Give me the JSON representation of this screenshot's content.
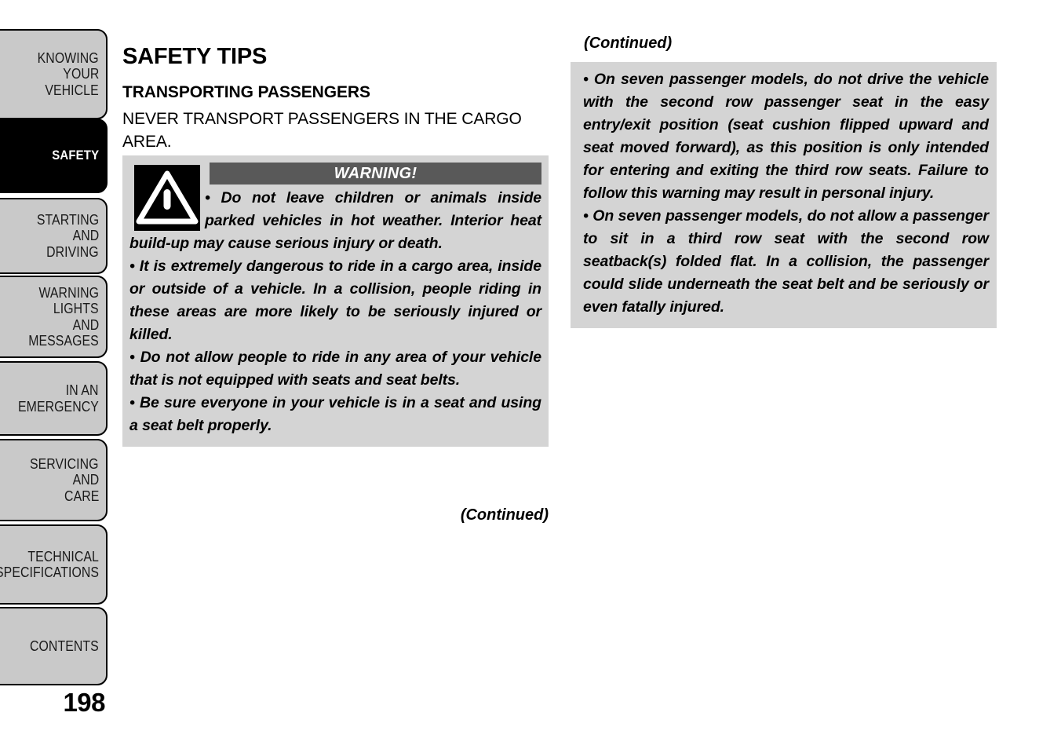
{
  "sidebar": {
    "tabs": [
      {
        "id": "knowing-your-vehicle",
        "lines": [
          "KNOWING",
          "YOUR",
          "VEHICLE"
        ],
        "active": false
      },
      {
        "id": "safety",
        "lines": [
          "SAFETY"
        ],
        "active": true
      },
      {
        "id": "starting-and-driving",
        "lines": [
          "STARTING",
          "AND",
          "DRIVING"
        ],
        "active": false
      },
      {
        "id": "warning-lights-and-messages",
        "lines": [
          "WARNING",
          "LIGHTS",
          "AND",
          "MESSAGES"
        ],
        "active": false
      },
      {
        "id": "in-an-emergency",
        "lines": [
          "IN AN",
          "EMERGENCY"
        ],
        "active": false
      },
      {
        "id": "servicing-and-care",
        "lines": [
          "SERVICING",
          "AND",
          "CARE"
        ],
        "active": false
      },
      {
        "id": "technical-specifications",
        "lines": [
          "TECHNICAL",
          "SPECIFICATIONS"
        ],
        "active": false
      },
      {
        "id": "contents",
        "lines": [
          "CONTENTS"
        ],
        "active": false
      }
    ],
    "page_number": "198"
  },
  "colors": {
    "tab_inactive_bg": "#c9c9c9",
    "tab_active_bg": "#000000",
    "warning_box_bg": "#d4d4d4",
    "warning_banner_bg": "#595959",
    "text": "#000000"
  },
  "left": {
    "section_title": "SAFETY TIPS",
    "subsection_title": "TRANSPORTING PASSENGERS",
    "intro_text": "NEVER TRANSPORT PASSENGERS IN THE CARGO AREA.",
    "warning": {
      "icon_name": "warning-triangle-icon",
      "banner_label": "WARNING!",
      "items": [
        "•  Do not leave children or animals inside parked vehicles in hot weather. Interior heat build-up may cause serious injury or death.",
        "•  It is extremely dangerous to ride in a cargo area, inside or outside of a vehicle. In a collision, people riding in these areas are more likely to be seriously injured or killed.",
        "•  Do not allow people to ride in any area of your vehicle that is not equipped with seats and seat belts.",
        "•  Be sure everyone in your vehicle is in a seat and using a seat belt properly."
      ]
    },
    "continued_label": "(Continued)"
  },
  "right": {
    "continued_label": "(Continued)",
    "warning": {
      "items": [
        "•  On seven passenger models, do not drive the vehicle with the second row passenger seat in the easy entry/exit position (seat cushion flipped upward and seat moved forward), as this position is only intended for entering and exiting the third row seats. Failure to follow this warning may result in personal injury.",
        "•  On seven passenger models, do not allow a passenger to sit in a third row seat with the second row seatback(s) folded flat. In a collision, the passenger could slide underneath the seat belt and be seriously or even fatally injured."
      ]
    }
  }
}
